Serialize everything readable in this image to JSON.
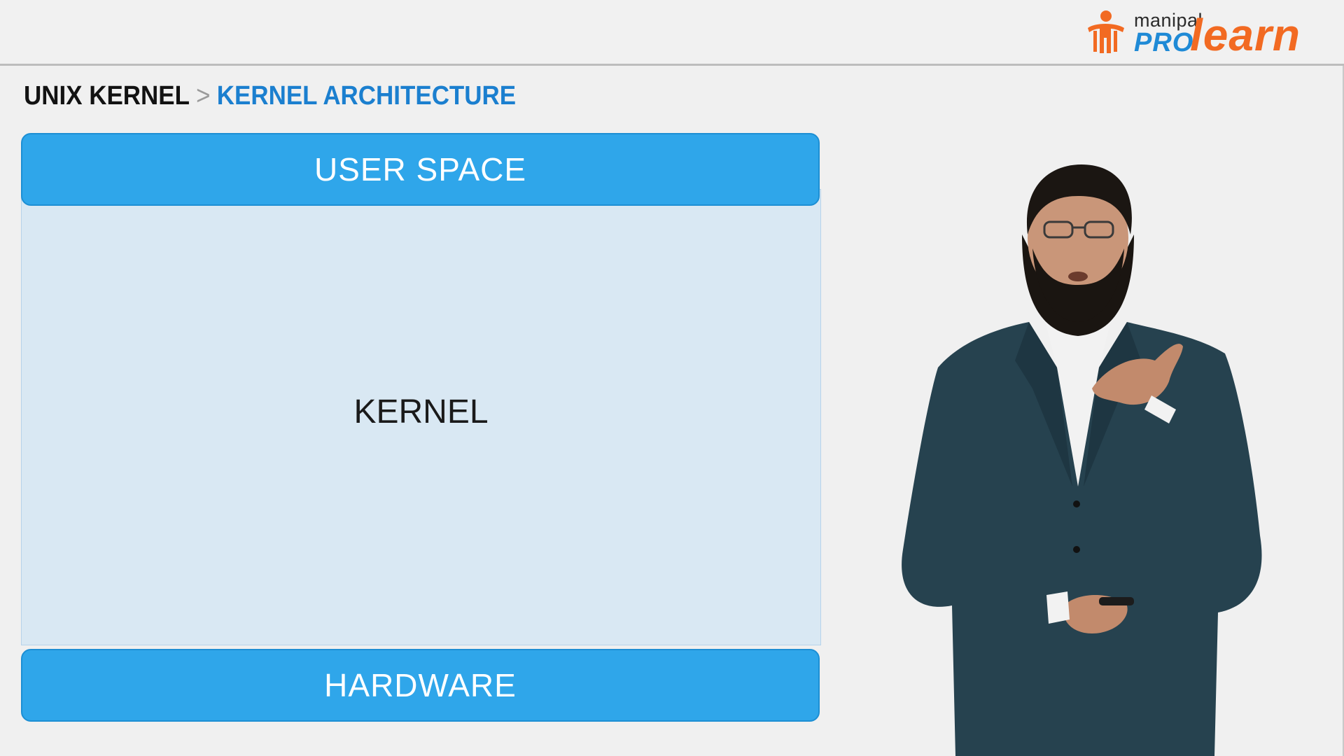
{
  "logo": {
    "small_text": "manipal",
    "pro_text": "PRO",
    "learn_text": "learn",
    "brand_orange": "#f26a22",
    "brand_blue": "#1f8ad6",
    "icon": "person-figure-icon"
  },
  "breadcrumb": {
    "parent": "UNIX KERNEL",
    "separator": ">",
    "current": "KERNEL ARCHITECTURE"
  },
  "diagram": {
    "top_layer": "USER SPACE",
    "middle_layer": "KERNEL",
    "bottom_layer": "HARDWARE",
    "layer_color": "#2fa6ea",
    "kernel_color": "#d9e8f3"
  },
  "presenter": {
    "icon": "presenter-figure"
  }
}
